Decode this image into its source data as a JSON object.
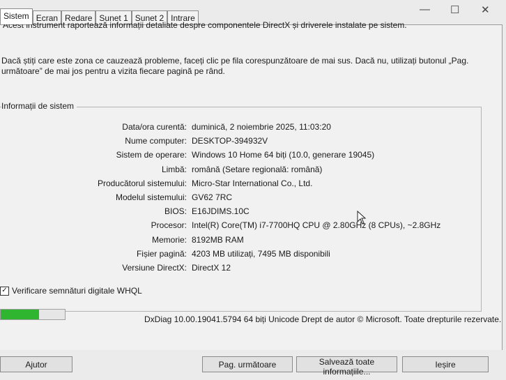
{
  "tabs": [
    "Sistem",
    "Ecran",
    "Redare",
    "Sunet 1",
    "Sunet 2",
    "Intrare"
  ],
  "window_controls": {
    "minimize": "—",
    "maximize": "☐",
    "close": "✕"
  },
  "intro": {
    "line1": "Acest instrument raportează informații detaliate despre componentele DirectX și driverele instalate pe sistem.",
    "line2": "Dacă știți care este zona ce cauzează probleme, faceți clic pe fila corespunzătoare de mai sus. Dacă nu, utilizați butonul „Pag. următoare” de mai jos pentru a vizita fiecare pagină pe rând."
  },
  "system_info": {
    "title": "Informații de sistem",
    "rows": [
      {
        "label": "Data/ora curentă:",
        "value": "duminică, 2 noiembrie 2025, 11:03:20"
      },
      {
        "label": "Nume computer:",
        "value": "DESKTOP-394932V"
      },
      {
        "label": "Sistem de operare:",
        "value": "Windows 10 Home 64 biți (10.0, generare 19045)"
      },
      {
        "label": "Limbă:",
        "value": "română (Setare regională: română)"
      },
      {
        "label": "Producătorul sistemului:",
        "value": "Micro-Star International Co., Ltd."
      },
      {
        "label": "Modelul sistemului:",
        "value": "GV62 7RC"
      },
      {
        "label": "BIOS:",
        "value": "E16JDIMS.10C"
      },
      {
        "label": "Procesor:",
        "value": "Intel(R) Core(TM) i7-7700HQ CPU @ 2.80GHz (8 CPUs), ~2.8GHz"
      },
      {
        "label": "Memorie:",
        "value": "8192MB RAM"
      },
      {
        "label": "Fișier pagină:",
        "value": "4203 MB utilizați, 7495 MB disponibili"
      },
      {
        "label": "Versiune DirectX:",
        "value": "DirectX 12"
      }
    ]
  },
  "whql": {
    "label": "Verificare semnături digitale WHQL",
    "checked": true,
    "check_glyph": "✓"
  },
  "progress": {
    "fraction": 0.6,
    "color": "#2fb52f"
  },
  "footer": {
    "text": "DxDiag 10.00.19041.5794 64 biți Unicode  Drept de autor © Microsoft. Toate drepturile rezervate."
  },
  "buttons": {
    "help": "Ajutor",
    "next_page": "Pag. următoare",
    "save_all": "Salvează toate informațiile...",
    "exit": "Ieșire"
  }
}
